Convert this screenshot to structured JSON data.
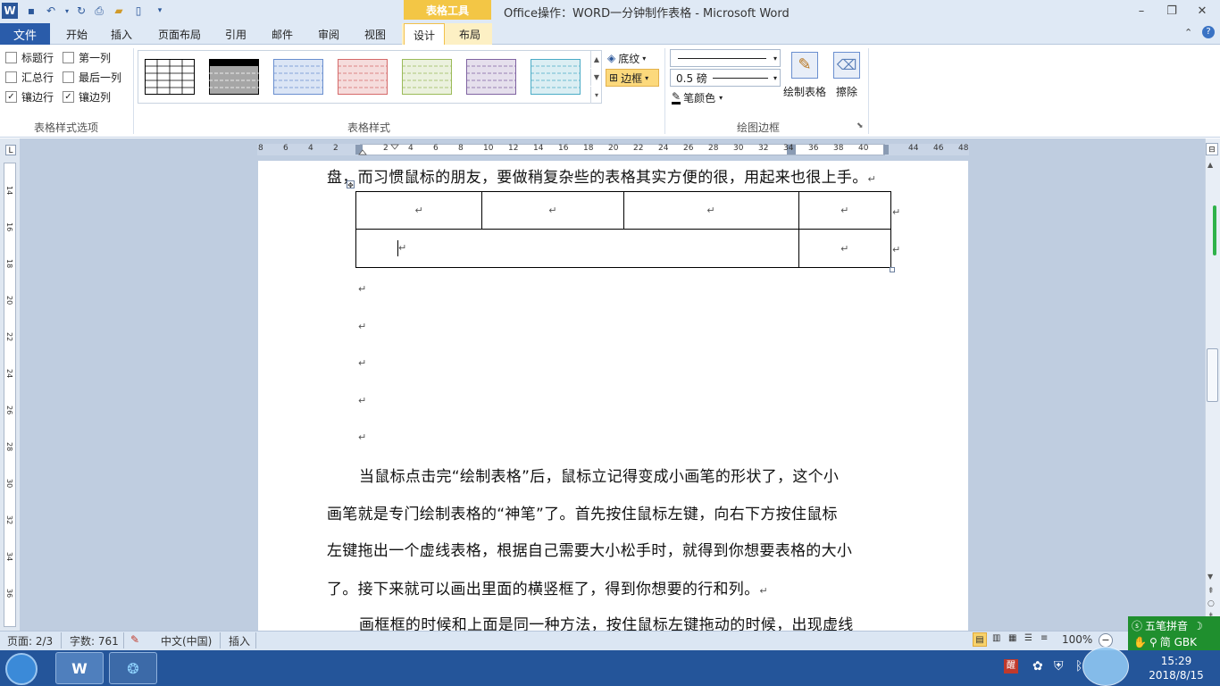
{
  "window": {
    "title": "Office操作：WORD一分钟制作表格 - Microsoft Word",
    "contextual_tab": "表格工具",
    "controls": {
      "minimize": "–",
      "restore": "❐",
      "close": "✕"
    }
  },
  "quick_access": {
    "word_icon": "W"
  },
  "tabs": {
    "file": "文件",
    "items": [
      "开始",
      "插入",
      "页面布局",
      "引用",
      "邮件",
      "审阅",
      "视图",
      "设计",
      "布局"
    ]
  },
  "ribbon": {
    "style_options": {
      "header_row": "标题行",
      "first_column": "第一列",
      "total_row": "汇总行",
      "last_column": "最后一列",
      "banded_rows": "镶边行",
      "banded_columns": "镶边列",
      "checked": "✓",
      "group_label": "表格样式选项"
    },
    "table_styles": {
      "group_label": "表格样式",
      "swatches": [
        "#000000",
        "#000000",
        "#6a8fcf",
        "#d56a6a",
        "#9bbb59",
        "#8064a2",
        "#4bacc6"
      ]
    },
    "shading_label": "底纹",
    "borders_label": "边框",
    "draw_borders": {
      "line_weight": "0.5 磅",
      "pen_color": "笔颜色",
      "draw_table": "绘制表格",
      "eraser": "擦除",
      "group_label": "绘图边框"
    }
  },
  "ruler": {
    "h_ticks": [
      "8",
      "6",
      "4",
      "2",
      "2",
      "4",
      "6",
      "8",
      "10",
      "12",
      "14",
      "16",
      "18",
      "20",
      "22",
      "24",
      "26",
      "28",
      "30",
      "32",
      "34",
      "36",
      "38",
      "40",
      "44",
      "46",
      "48"
    ],
    "v_ticks": [
      "14",
      "16",
      "18",
      "20",
      "22",
      "24",
      "26",
      "28",
      "30",
      "32",
      "34",
      "36"
    ]
  },
  "document": {
    "line1": "盘，而习惯鼠标的朋友，要做稍复杂些的表格其实方便的很，用起来也很上手。",
    "para_mark": "↵",
    "para2": [
      "当鼠标点击完“绘制表格”后，鼠标立记得变成小画笔的形状了，这个小",
      "画笔就是专门绘制表格的“神笔”了。首先按住鼠标左键，向右下方按住鼠标",
      "左键拖出一个虚线表格，根据自己需要大小松手时，就得到你想要表格的大小",
      "了。接下来就可以画出里面的横竖框了，得到你想要的行和列。"
    ],
    "para3": "画框框的时候和上面是同一种方法，按住鼠标左键拖动的时候，出现虚线"
  },
  "status": {
    "page": "页面: 2/3",
    "words": "字数: 761",
    "language": "中文(中国)",
    "mode": "插入",
    "zoom": "100%"
  },
  "ime": {
    "name": "五笔拼音",
    "mode": "简 GBK"
  },
  "clock": {
    "time": "15:29",
    "date": "2018/8/15"
  }
}
